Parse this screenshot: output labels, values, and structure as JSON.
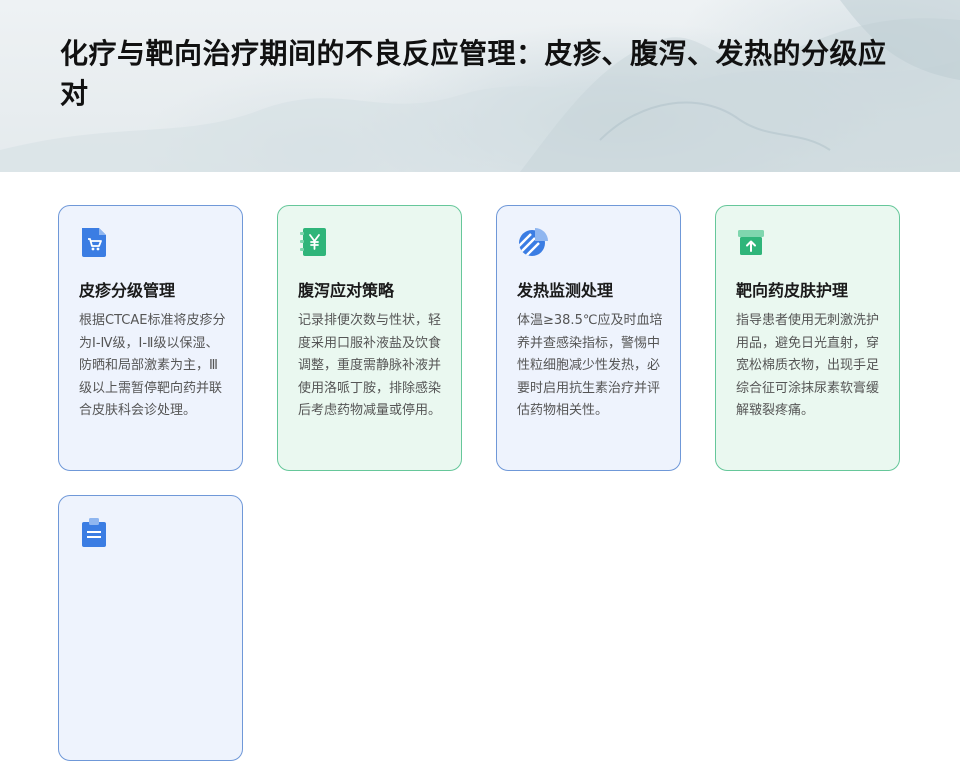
{
  "page": {
    "title": "化疗与靶向治疗期间的不良反应管理：皮疹、腹泻、发热的分级应对"
  },
  "cards": [
    {
      "icon": "shopping-cart-icon",
      "accent": "#3b7de3",
      "title": "皮疹分级管理",
      "body": "根据CTCAE标准将皮疹分为Ⅰ-Ⅳ级，Ⅰ-Ⅱ级以保湿、防晒和局部激素为主，Ⅲ级以上需暂停靶向药并联合皮肤科会诊处理。"
    },
    {
      "icon": "yen-bill-icon",
      "accent": "#2fb57a",
      "title": "腹泻应对策略",
      "body": "记录排便次数与性状，轻度采用口服补液盐及饮食调整，重度需静脉补液并使用洛哌丁胺，排除感染后考虑药物减量或停用。"
    },
    {
      "icon": "pie-chart-icon",
      "accent": "#3b7de3",
      "title": "发热监测处理",
      "body": "体温≥38.5℃应及时血培养并查感染指标，警惕中性粒细胞减少性发热，必要时启用抗生素治疗并评估药物相关性。"
    },
    {
      "icon": "box-upload-icon",
      "accent": "#2fb57a",
      "title": "靶向药皮肤护理",
      "body": "指导患者使用无刺激洗护用品，避免日光直射，穿宽松棉质衣物，出现手足综合征可涂抹尿素软膏缓解皲裂疼痛。"
    },
    {
      "icon": "clipboard-icon",
      "accent": "#3b7de3",
      "title": "",
      "body": ""
    }
  ]
}
